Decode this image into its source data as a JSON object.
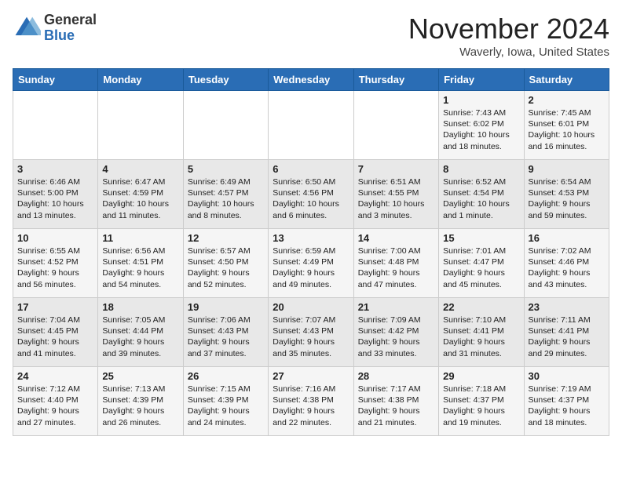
{
  "header": {
    "logo_line1": "General",
    "logo_line2": "Blue",
    "month_title": "November 2024",
    "location": "Waverly, Iowa, United States"
  },
  "weekdays": [
    "Sunday",
    "Monday",
    "Tuesday",
    "Wednesday",
    "Thursday",
    "Friday",
    "Saturday"
  ],
  "weeks": [
    [
      {
        "day": "",
        "info": ""
      },
      {
        "day": "",
        "info": ""
      },
      {
        "day": "",
        "info": ""
      },
      {
        "day": "",
        "info": ""
      },
      {
        "day": "",
        "info": ""
      },
      {
        "day": "1",
        "info": "Sunrise: 7:43 AM\nSunset: 6:02 PM\nDaylight: 10 hours\nand 18 minutes."
      },
      {
        "day": "2",
        "info": "Sunrise: 7:45 AM\nSunset: 6:01 PM\nDaylight: 10 hours\nand 16 minutes."
      }
    ],
    [
      {
        "day": "3",
        "info": "Sunrise: 6:46 AM\nSunset: 5:00 PM\nDaylight: 10 hours\nand 13 minutes."
      },
      {
        "day": "4",
        "info": "Sunrise: 6:47 AM\nSunset: 4:59 PM\nDaylight: 10 hours\nand 11 minutes."
      },
      {
        "day": "5",
        "info": "Sunrise: 6:49 AM\nSunset: 4:57 PM\nDaylight: 10 hours\nand 8 minutes."
      },
      {
        "day": "6",
        "info": "Sunrise: 6:50 AM\nSunset: 4:56 PM\nDaylight: 10 hours\nand 6 minutes."
      },
      {
        "day": "7",
        "info": "Sunrise: 6:51 AM\nSunset: 4:55 PM\nDaylight: 10 hours\nand 3 minutes."
      },
      {
        "day": "8",
        "info": "Sunrise: 6:52 AM\nSunset: 4:54 PM\nDaylight: 10 hours\nand 1 minute."
      },
      {
        "day": "9",
        "info": "Sunrise: 6:54 AM\nSunset: 4:53 PM\nDaylight: 9 hours\nand 59 minutes."
      }
    ],
    [
      {
        "day": "10",
        "info": "Sunrise: 6:55 AM\nSunset: 4:52 PM\nDaylight: 9 hours\nand 56 minutes."
      },
      {
        "day": "11",
        "info": "Sunrise: 6:56 AM\nSunset: 4:51 PM\nDaylight: 9 hours\nand 54 minutes."
      },
      {
        "day": "12",
        "info": "Sunrise: 6:57 AM\nSunset: 4:50 PM\nDaylight: 9 hours\nand 52 minutes."
      },
      {
        "day": "13",
        "info": "Sunrise: 6:59 AM\nSunset: 4:49 PM\nDaylight: 9 hours\nand 49 minutes."
      },
      {
        "day": "14",
        "info": "Sunrise: 7:00 AM\nSunset: 4:48 PM\nDaylight: 9 hours\nand 47 minutes."
      },
      {
        "day": "15",
        "info": "Sunrise: 7:01 AM\nSunset: 4:47 PM\nDaylight: 9 hours\nand 45 minutes."
      },
      {
        "day": "16",
        "info": "Sunrise: 7:02 AM\nSunset: 4:46 PM\nDaylight: 9 hours\nand 43 minutes."
      }
    ],
    [
      {
        "day": "17",
        "info": "Sunrise: 7:04 AM\nSunset: 4:45 PM\nDaylight: 9 hours\nand 41 minutes."
      },
      {
        "day": "18",
        "info": "Sunrise: 7:05 AM\nSunset: 4:44 PM\nDaylight: 9 hours\nand 39 minutes."
      },
      {
        "day": "19",
        "info": "Sunrise: 7:06 AM\nSunset: 4:43 PM\nDaylight: 9 hours\nand 37 minutes."
      },
      {
        "day": "20",
        "info": "Sunrise: 7:07 AM\nSunset: 4:43 PM\nDaylight: 9 hours\nand 35 minutes."
      },
      {
        "day": "21",
        "info": "Sunrise: 7:09 AM\nSunset: 4:42 PM\nDaylight: 9 hours\nand 33 minutes."
      },
      {
        "day": "22",
        "info": "Sunrise: 7:10 AM\nSunset: 4:41 PM\nDaylight: 9 hours\nand 31 minutes."
      },
      {
        "day": "23",
        "info": "Sunrise: 7:11 AM\nSunset: 4:41 PM\nDaylight: 9 hours\nand 29 minutes."
      }
    ],
    [
      {
        "day": "24",
        "info": "Sunrise: 7:12 AM\nSunset: 4:40 PM\nDaylight: 9 hours\nand 27 minutes."
      },
      {
        "day": "25",
        "info": "Sunrise: 7:13 AM\nSunset: 4:39 PM\nDaylight: 9 hours\nand 26 minutes."
      },
      {
        "day": "26",
        "info": "Sunrise: 7:15 AM\nSunset: 4:39 PM\nDaylight: 9 hours\nand 24 minutes."
      },
      {
        "day": "27",
        "info": "Sunrise: 7:16 AM\nSunset: 4:38 PM\nDaylight: 9 hours\nand 22 minutes."
      },
      {
        "day": "28",
        "info": "Sunrise: 7:17 AM\nSunset: 4:38 PM\nDaylight: 9 hours\nand 21 minutes."
      },
      {
        "day": "29",
        "info": "Sunrise: 7:18 AM\nSunset: 4:37 PM\nDaylight: 9 hours\nand 19 minutes."
      },
      {
        "day": "30",
        "info": "Sunrise: 7:19 AM\nSunset: 4:37 PM\nDaylight: 9 hours\nand 18 minutes."
      }
    ]
  ]
}
